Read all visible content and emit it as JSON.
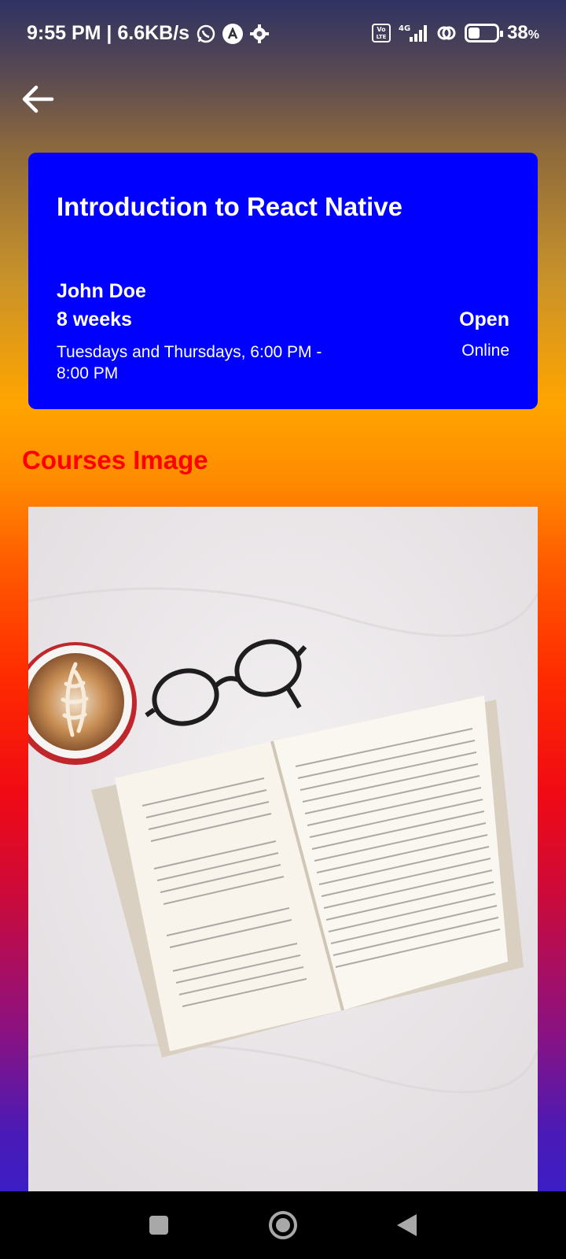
{
  "status_bar": {
    "time_speed": "9:55 PM | 6.6KB/s",
    "network_badge": "Vo\nLTE",
    "network_type": "4G",
    "battery_percent": "38",
    "battery_unit": "%"
  },
  "header": {
    "back_icon": "arrow-left-icon"
  },
  "course": {
    "title": "Introduction to React Native",
    "instructor": "John Doe",
    "duration": "8 weeks",
    "schedule": "Tuesdays and Thursdays, 6:00 PM - 8:00 PM",
    "status": "Open",
    "mode": "Online"
  },
  "section": {
    "image_title": "Courses Image"
  },
  "colors": {
    "card_bg": "#0000ff",
    "section_title": "#ff0000"
  }
}
